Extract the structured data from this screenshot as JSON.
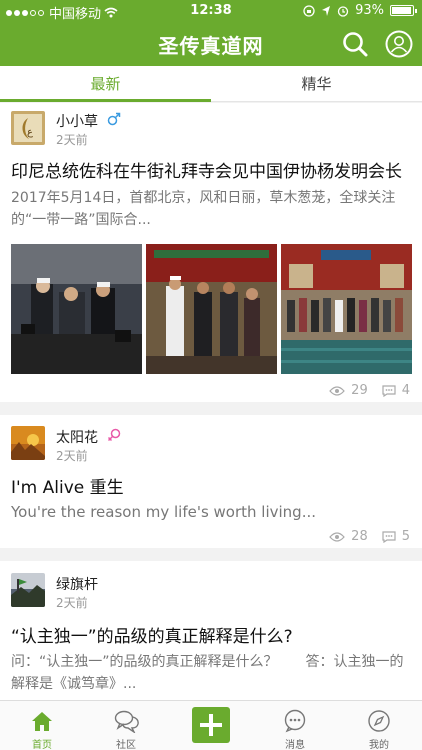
{
  "status_bar": {
    "carrier": "中国移动",
    "time": "12:38",
    "battery": "93%"
  },
  "header": {
    "title": "圣传真道网",
    "search_icon": "search-icon",
    "profile_icon": "user-profile-icon"
  },
  "tabs": [
    {
      "label": "最新",
      "active": true
    },
    {
      "label": "精华",
      "active": false
    }
  ],
  "posts": [
    {
      "username": "小小草",
      "gender": "male",
      "time": "2天前",
      "title": "印尼总统佐科在牛街礼拜寺会见中国伊协杨发明会长",
      "excerpt": "2017年5月14日，首都北京，风和日丽，草木葱茏，全球关注的“一带一路”国际合...",
      "views": "29",
      "comments": "4"
    },
    {
      "username": "太阳花",
      "gender": "female",
      "time": "2天前",
      "title": "I'm Alive 重生",
      "excerpt": "You're the reason my life's worth living...",
      "views": "28",
      "comments": "5"
    },
    {
      "username": "绿旗杆",
      "gender": "",
      "time": "2天前",
      "title": "“认主独一”的品级的真正解释是什么?",
      "excerpt": "问：“认主独一”的品级的真正解释是什么？　　答：认主独一的解释是《诚笃章》...",
      "views": "",
      "comments": ""
    }
  ],
  "tab_bar": [
    {
      "label": "首页",
      "icon": "home-icon",
      "active": true
    },
    {
      "label": "社区",
      "icon": "chat-bubbles-icon",
      "active": false
    },
    {
      "label": "",
      "icon": "plus-icon",
      "active": false
    },
    {
      "label": "消息",
      "icon": "message-icon",
      "active": false
    },
    {
      "label": "我的",
      "icon": "compass-icon",
      "active": false
    }
  ],
  "colors": {
    "brand": "#6aab2e",
    "female": "#e85aa8",
    "male": "#3b9be0"
  }
}
